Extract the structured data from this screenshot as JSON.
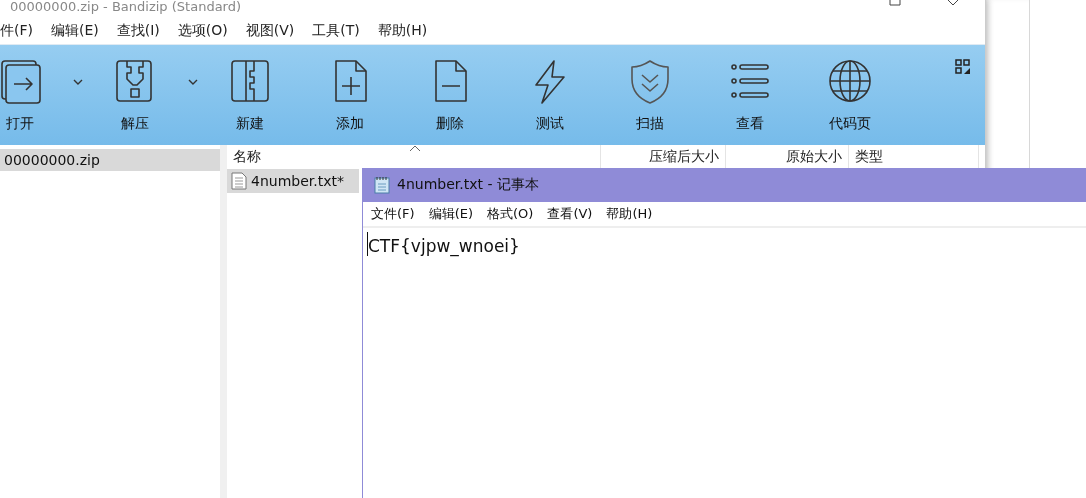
{
  "bandizip": {
    "title": "00000000.zip - Bandizip (Standard)",
    "menu": [
      "件(F)",
      "编辑(E)",
      "查找(I)",
      "选项(O)",
      "视图(V)",
      "工具(T)",
      "帮助(H)"
    ],
    "toolbar": [
      {
        "kind": "open",
        "label": "打开",
        "has_dropdown": true
      },
      {
        "kind": "extract",
        "label": "解压",
        "has_dropdown": true
      },
      {
        "kind": "new",
        "label": "新建",
        "has_dropdown": false
      },
      {
        "kind": "add",
        "label": "添加",
        "has_dropdown": false
      },
      {
        "kind": "delete",
        "label": "删除",
        "has_dropdown": false
      },
      {
        "kind": "test",
        "label": "测试",
        "has_dropdown": false
      },
      {
        "kind": "scan",
        "label": "扫描",
        "has_dropdown": false
      },
      {
        "kind": "view",
        "label": "查看",
        "has_dropdown": false
      },
      {
        "kind": "codepage",
        "label": "代码页",
        "has_dropdown": false
      }
    ],
    "folders": [
      {
        "label": "00000000.zip",
        "selected": true
      }
    ],
    "columns": [
      "名称",
      "压缩后大小",
      "原始大小",
      "类型"
    ],
    "files": [
      {
        "name": "4number.txt*",
        "selected": true
      }
    ]
  },
  "notepad": {
    "title": "4number.txt - 记事本",
    "menu": [
      "文件(F)",
      "编辑(E)",
      "格式(O)",
      "查看(V)",
      "帮助(H)"
    ],
    "content": "CTF{vjpw_wnoei}"
  }
}
